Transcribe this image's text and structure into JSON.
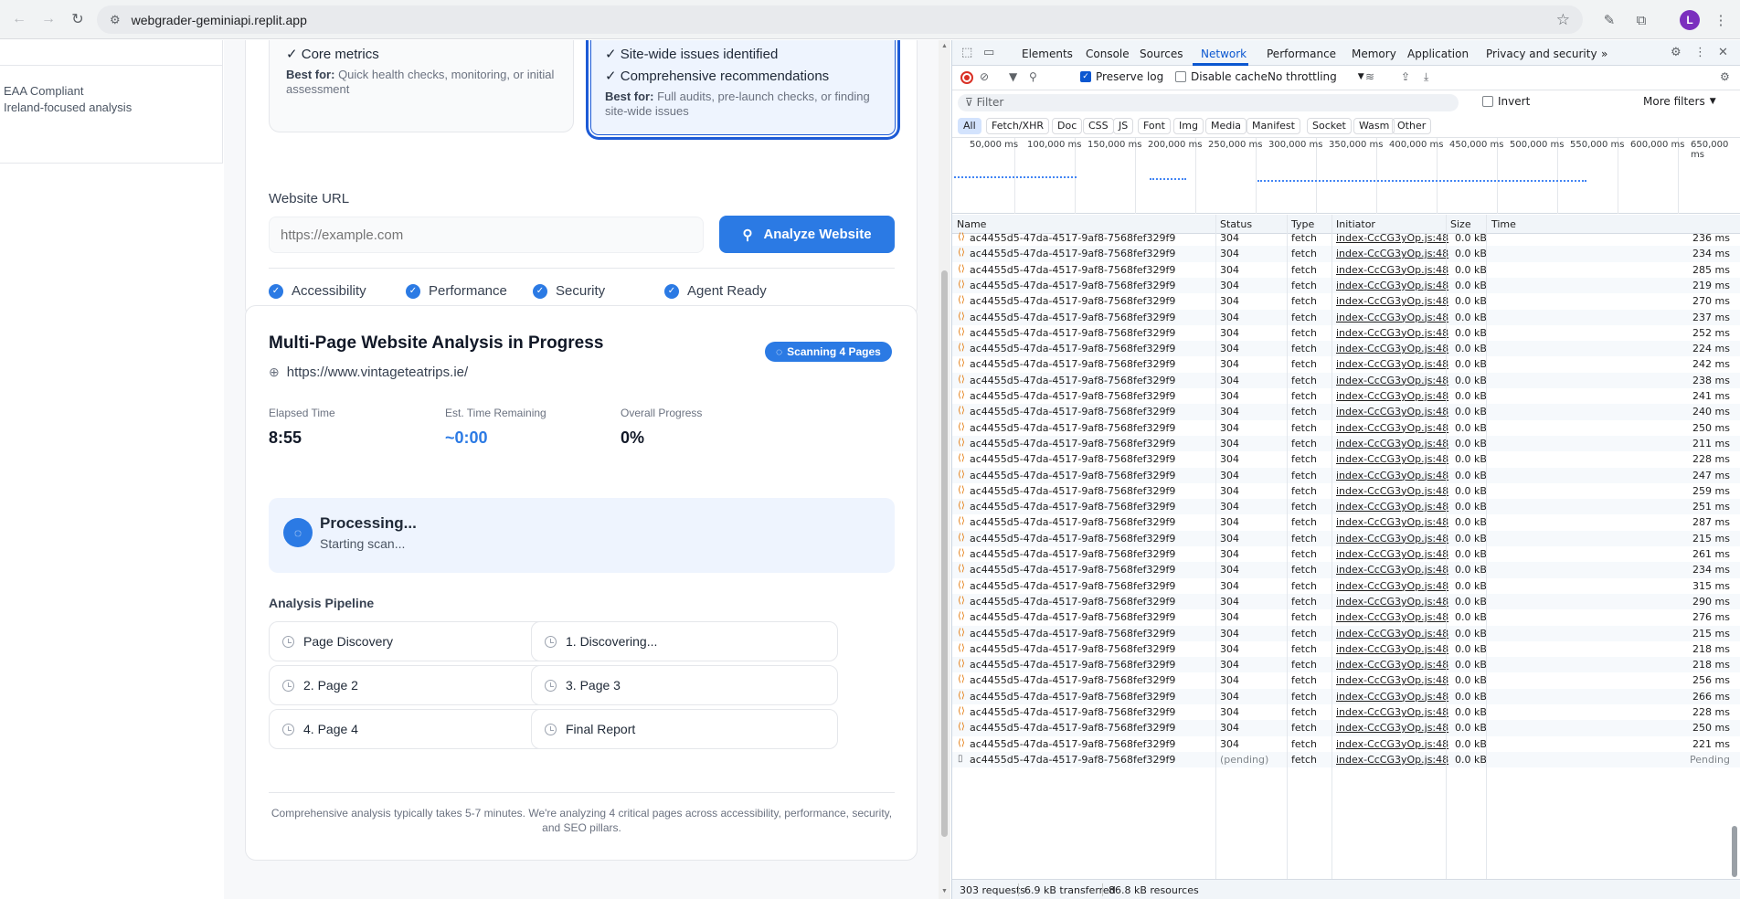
{
  "browser": {
    "url": "webgrader-geminiapi.replit.app",
    "avatar_letter": "L"
  },
  "sidebar": {
    "eaa_title": "EAA Compliant",
    "eaa_subtitle": "Ireland-focused analysis"
  },
  "plans": {
    "quick": {
      "line1": "✓ Core metrics",
      "best_label": "Best for:",
      "best_text": " Quick health checks, monitoring, or initial assessment"
    },
    "full": {
      "line1": "✓ Site-wide issues identified",
      "line2": "✓ Comprehensive recommendations",
      "best_label": "Best for:",
      "best_text": " Full audits, pre-launch checks, or finding site-wide issues"
    }
  },
  "url_form": {
    "label": "Website URL",
    "placeholder": "https://example.com",
    "analyze_label": "Analyze Website",
    "checks": [
      "Accessibility",
      "Performance",
      "Security",
      "Agent Ready"
    ]
  },
  "progress": {
    "title": "Multi-Page Website Analysis in Progress",
    "badge": "Scanning 4 Pages",
    "site_url": "https://www.vintageteatrips.ie/",
    "elapsed_label": "Elapsed Time",
    "elapsed_value": "8:55",
    "remaining_label": "Est. Time Remaining",
    "remaining_value": "~0:00",
    "overall_label": "Overall Progress",
    "overall_value": "0%",
    "processing_title": "Processing...",
    "processing_sub": "Starting scan...",
    "pipeline_title": "Analysis Pipeline",
    "steps": [
      "Page Discovery",
      "1. Discovering...",
      "2. Page 2",
      "3. Page 3",
      "4. Page 4",
      "Final Report"
    ],
    "footer_note": "Comprehensive analysis typically takes 5-7 minutes. We're analyzing 4 critical pages across accessibility, performance, security, and SEO pillars."
  },
  "devtools": {
    "tabs": [
      "Elements",
      "Console",
      "Sources",
      "Network",
      "Performance",
      "Memory",
      "Application",
      "Privacy and security"
    ],
    "active_tab": "Network",
    "more_tabs": "»",
    "preserve_log": "Preserve log",
    "disable_cache": "Disable cache",
    "throttling": "No throttling",
    "filter_placeholder": "Filter",
    "invert": "Invert",
    "more_filters": "More filters",
    "type_filters": [
      "All",
      "Fetch/XHR",
      "Doc",
      "CSS",
      "JS",
      "Font",
      "Img",
      "Media",
      "Manifest",
      "Socket",
      "Wasm",
      "Other"
    ],
    "timeline_labels": [
      "50,000 ms",
      "100,000 ms",
      "150,000 ms",
      "200,000 ms",
      "250,000 ms",
      "300,000 ms",
      "350,000 ms",
      "400,000 ms",
      "450,000 ms",
      "500,000 ms",
      "550,000 ms",
      "600,000 ms",
      "650,000 ms"
    ],
    "columns": [
      "Name",
      "Status",
      "Type",
      "Initiator",
      "Size",
      "Time"
    ],
    "request_name": "ac4455d5-47da-4517-9af8-7568fef329f9",
    "initiator": "index-CcCG3yOp.js:48",
    "rows": [
      {
        "status": "304",
        "type": "fetch",
        "size": "0.0 kB",
        "time": "236 ms"
      },
      {
        "status": "304",
        "type": "fetch",
        "size": "0.0 kB",
        "time": "234 ms"
      },
      {
        "status": "304",
        "type": "fetch",
        "size": "0.0 kB",
        "time": "285 ms"
      },
      {
        "status": "304",
        "type": "fetch",
        "size": "0.0 kB",
        "time": "219 ms"
      },
      {
        "status": "304",
        "type": "fetch",
        "size": "0.0 kB",
        "time": "270 ms"
      },
      {
        "status": "304",
        "type": "fetch",
        "size": "0.0 kB",
        "time": "237 ms"
      },
      {
        "status": "304",
        "type": "fetch",
        "size": "0.0 kB",
        "time": "252 ms"
      },
      {
        "status": "304",
        "type": "fetch",
        "size": "0.0 kB",
        "time": "224 ms"
      },
      {
        "status": "304",
        "type": "fetch",
        "size": "0.0 kB",
        "time": "242 ms"
      },
      {
        "status": "304",
        "type": "fetch",
        "size": "0.0 kB",
        "time": "238 ms"
      },
      {
        "status": "304",
        "type": "fetch",
        "size": "0.0 kB",
        "time": "241 ms"
      },
      {
        "status": "304",
        "type": "fetch",
        "size": "0.0 kB",
        "time": "240 ms"
      },
      {
        "status": "304",
        "type": "fetch",
        "size": "0.0 kB",
        "time": "250 ms"
      },
      {
        "status": "304",
        "type": "fetch",
        "size": "0.0 kB",
        "time": "211 ms"
      },
      {
        "status": "304",
        "type": "fetch",
        "size": "0.0 kB",
        "time": "228 ms"
      },
      {
        "status": "304",
        "type": "fetch",
        "size": "0.0 kB",
        "time": "247 ms"
      },
      {
        "status": "304",
        "type": "fetch",
        "size": "0.0 kB",
        "time": "259 ms"
      },
      {
        "status": "304",
        "type": "fetch",
        "size": "0.0 kB",
        "time": "251 ms"
      },
      {
        "status": "304",
        "type": "fetch",
        "size": "0.0 kB",
        "time": "287 ms"
      },
      {
        "status": "304",
        "type": "fetch",
        "size": "0.0 kB",
        "time": "215 ms"
      },
      {
        "status": "304",
        "type": "fetch",
        "size": "0.0 kB",
        "time": "261 ms"
      },
      {
        "status": "304",
        "type": "fetch",
        "size": "0.0 kB",
        "time": "234 ms"
      },
      {
        "status": "304",
        "type": "fetch",
        "size": "0.0 kB",
        "time": "315 ms"
      },
      {
        "status": "304",
        "type": "fetch",
        "size": "0.0 kB",
        "time": "290 ms"
      },
      {
        "status": "304",
        "type": "fetch",
        "size": "0.0 kB",
        "time": "276 ms"
      },
      {
        "status": "304",
        "type": "fetch",
        "size": "0.0 kB",
        "time": "215 ms"
      },
      {
        "status": "304",
        "type": "fetch",
        "size": "0.0 kB",
        "time": "218 ms"
      },
      {
        "status": "304",
        "type": "fetch",
        "size": "0.0 kB",
        "time": "218 ms"
      },
      {
        "status": "304",
        "type": "fetch",
        "size": "0.0 kB",
        "time": "256 ms"
      },
      {
        "status": "304",
        "type": "fetch",
        "size": "0.0 kB",
        "time": "266 ms"
      },
      {
        "status": "304",
        "type": "fetch",
        "size": "0.0 kB",
        "time": "228 ms"
      },
      {
        "status": "304",
        "type": "fetch",
        "size": "0.0 kB",
        "time": "250 ms"
      },
      {
        "status": "304",
        "type": "fetch",
        "size": "0.0 kB",
        "time": "221 ms"
      },
      {
        "status": "(pending)",
        "type": "fetch",
        "size": "0.0 kB",
        "time": "Pending"
      }
    ],
    "status_bar": {
      "requests": "303 requests",
      "transferred": "6.9 kB transferred",
      "resources": "86.8 kB resources"
    }
  }
}
